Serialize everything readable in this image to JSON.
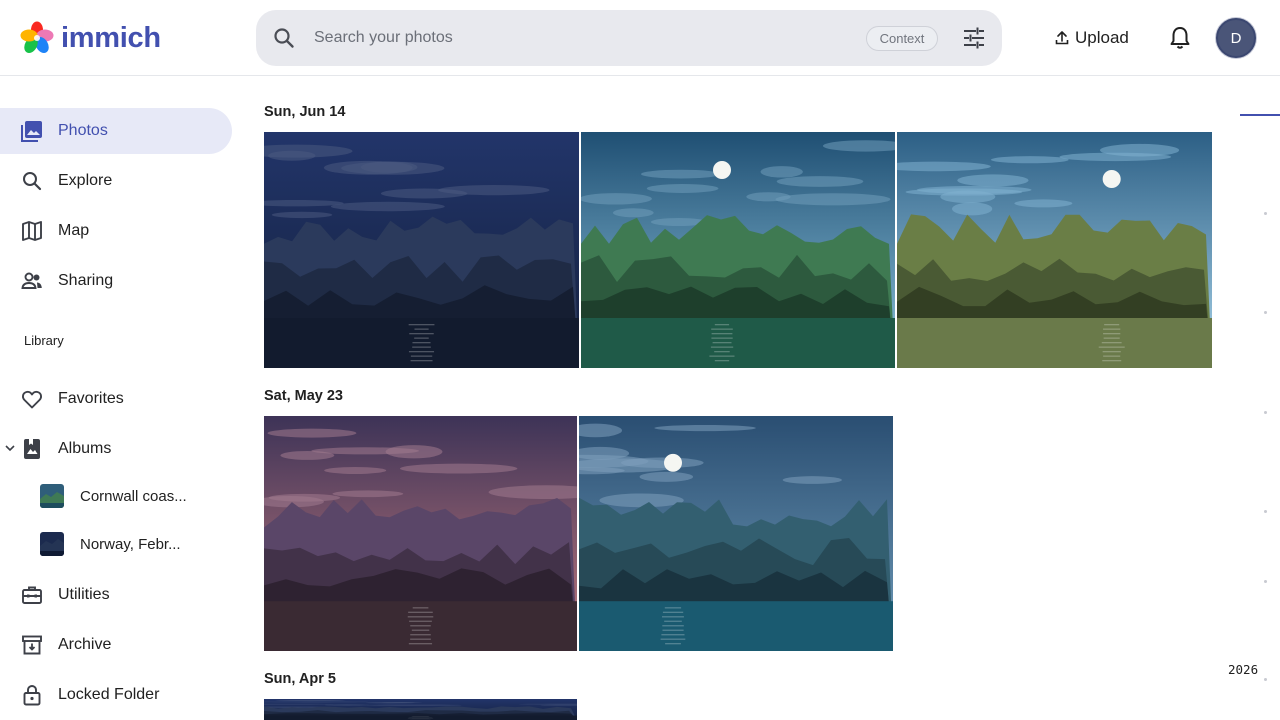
{
  "app": {
    "name": "immich"
  },
  "search": {
    "placeholder": "Search your photos",
    "value": "",
    "chip": "Context"
  },
  "header": {
    "upload_label": "Upload",
    "avatar_initial": "D"
  },
  "nav": {
    "photos": "Photos",
    "explore": "Explore",
    "map": "Map",
    "sharing": "Sharing",
    "library_label": "Library",
    "favorites": "Favorites",
    "albums": "Albums",
    "albums_list": [
      "Cornwall coas...",
      "Norway, Febr..."
    ],
    "utilities": "Utilities",
    "archive": "Archive",
    "locked_folder": "Locked Folder"
  },
  "timeline": {
    "groups": [
      {
        "date": "Sun, Jun 14"
      },
      {
        "date": "Sat, May 23"
      },
      {
        "date": "Sun, Apr 5"
      }
    ],
    "year": "2026"
  },
  "colors": {
    "accent": "#4250af",
    "active_bg": "#e7e9f7",
    "search_bg": "#e8e9ee"
  },
  "icons": [
    "search-icon",
    "tune-icon",
    "upload-icon",
    "bell-icon",
    "photos-icon",
    "explore-icon",
    "map-icon",
    "sharing-icon",
    "heart-icon",
    "album-icon",
    "chevron-down-icon",
    "utilities-icon",
    "archive-icon",
    "lock-icon"
  ]
}
